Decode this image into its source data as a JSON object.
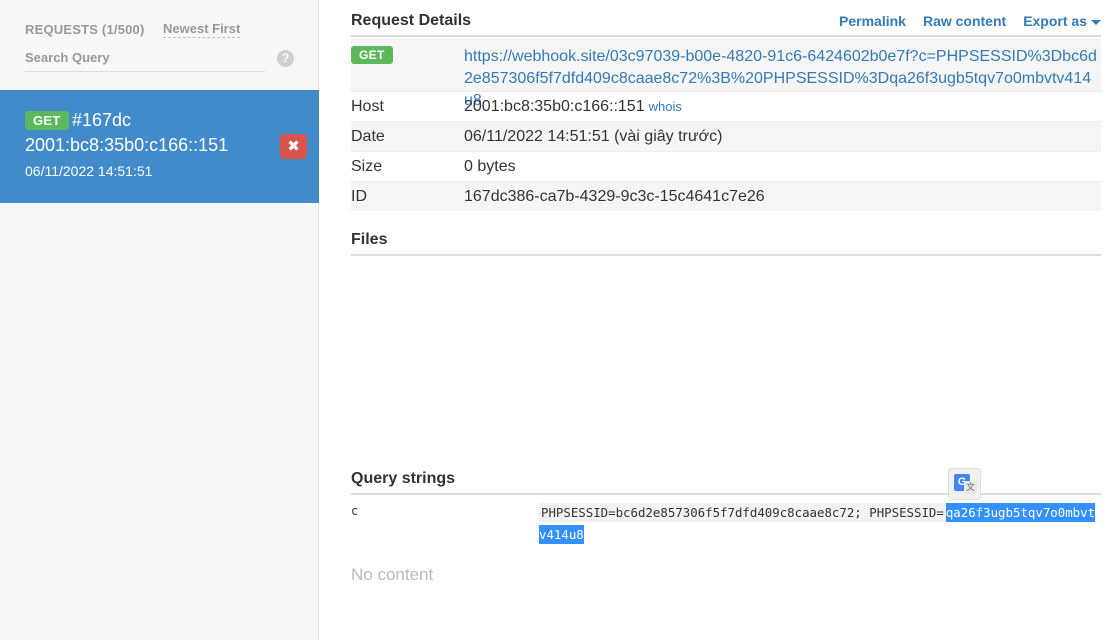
{
  "sidebar": {
    "requests_label": "REQUESTS (1/500)",
    "sort_label": "Newest First",
    "search_placeholder": "Search Query",
    "help_glyph": "?",
    "request": {
      "method": "GET",
      "id": "#167dc",
      "ip": "2001:bc8:35b0:c166::151",
      "date": "06/11/2022 14:51:51",
      "delete_glyph": "✖"
    }
  },
  "main": {
    "title": "Request Details",
    "actions": {
      "permalink": "Permalink",
      "raw_content": "Raw content",
      "export_as": "Export as"
    },
    "details": {
      "method": "GET",
      "url": "https://webhook.site/03c97039-b00e-4820-91c6-6424602b0e7f?c=PHPSESSID%3Dbc6d2e857306f5f7dfd409c8caae8c72%3B%20PHPSESSID%3Dqa26f3ugb5tqv7o0mbvtv414u8",
      "host_label": "Host",
      "host_value": "2001:bc8:35b0:c166::151",
      "whois_label": "whois",
      "date_label": "Date",
      "date_value": "06/11/2022 14:51:51 (vài giây trước)",
      "size_label": "Size",
      "size_value": "0 bytes",
      "id_label": "ID",
      "id_value": "167dc386-ca7b-4329-9c3c-15c4641c7e26"
    },
    "files_title": "Files",
    "query_strings": {
      "title": "Query strings",
      "key": "c",
      "value_plain": "PHPSESSID=bc6d2e857306f5f7dfd409c8caae8c72; PHPSESSID=",
      "value_selected": "qa26f3ugb5tqv7o0mbvtv414u8"
    },
    "no_content": "No content"
  },
  "colors": {
    "accent_blue": "#428bca",
    "link_blue": "#337ab7",
    "get_green": "#5cb85c",
    "delete_red": "#d9534f",
    "selection": "#3390ff"
  },
  "icons": {
    "help": "help-icon",
    "delete": "close-icon",
    "caret": "caret-down-icon",
    "translate": "google-translate-icon"
  }
}
